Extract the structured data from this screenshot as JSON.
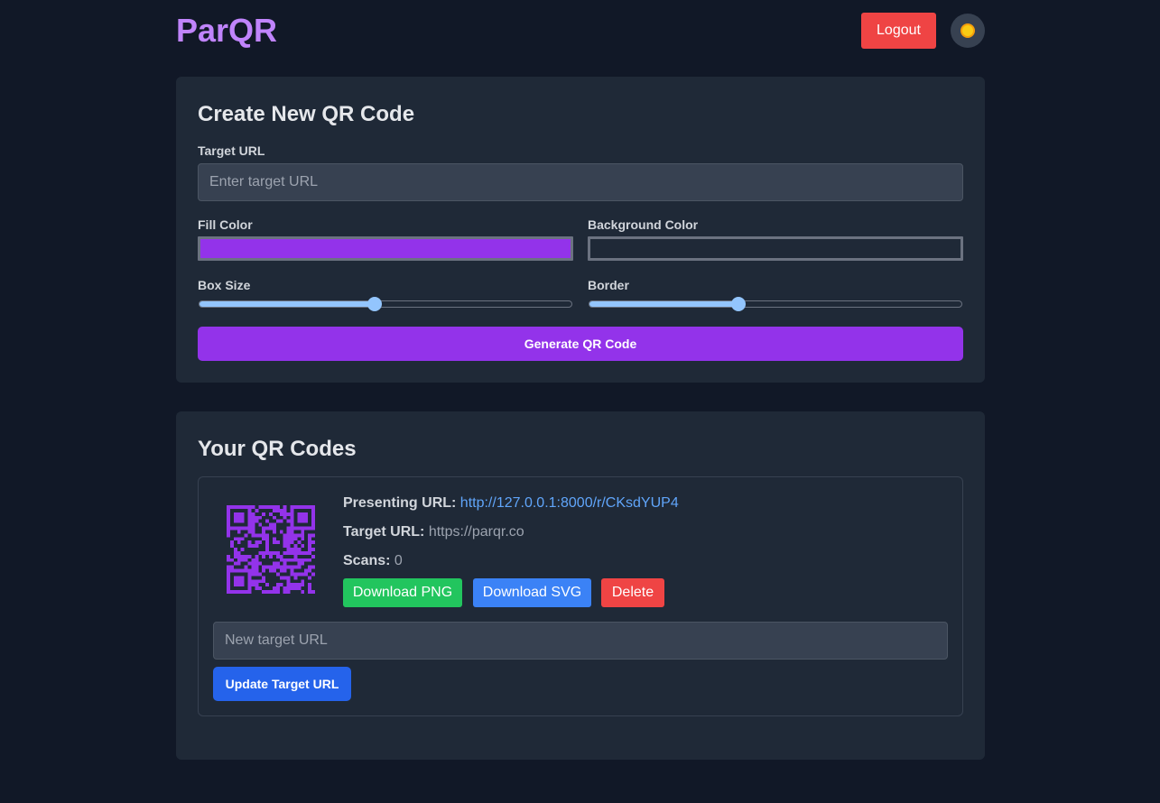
{
  "header": {
    "logo": "ParQR",
    "logout_label": "Logout",
    "theme_icon": "sun-icon"
  },
  "create": {
    "title": "Create New QR Code",
    "target_url_label": "Target URL",
    "target_url_placeholder": "Enter target URL",
    "target_url_value": "",
    "fill_color_label": "Fill Color",
    "fill_color": "#9333ea",
    "background_color_label": "Background Color",
    "background_color": "#1f2937",
    "box_size_label": "Box Size",
    "box_size_fraction": 0.47,
    "border_label": "Border",
    "border_fraction": 0.4,
    "generate_label": "Generate QR Code"
  },
  "list": {
    "title": "Your QR Codes",
    "items": [
      {
        "presenting_label": "Presenting URL:",
        "presenting_url": "http://127.0.0.1:8000/r/CKsdYUP4",
        "target_label": "Target URL:",
        "target_url": "https://parqr.co",
        "scans_label": "Scans:",
        "scans": "0",
        "download_png_label": "Download PNG",
        "download_svg_label": "Download SVG",
        "delete_label": "Delete",
        "new_target_placeholder": "New target URL",
        "new_target_value": "",
        "update_label": "Update Target URL",
        "qr_color": "#9333ea"
      }
    ]
  },
  "colors": {
    "page_bg": "#111827",
    "card_bg": "#1f2937",
    "accent": "#9333ea",
    "logo": "#c084fc",
    "danger": "#ef4444",
    "success": "#22c55e",
    "primary": "#3b82f6",
    "link": "#60a5fa"
  }
}
